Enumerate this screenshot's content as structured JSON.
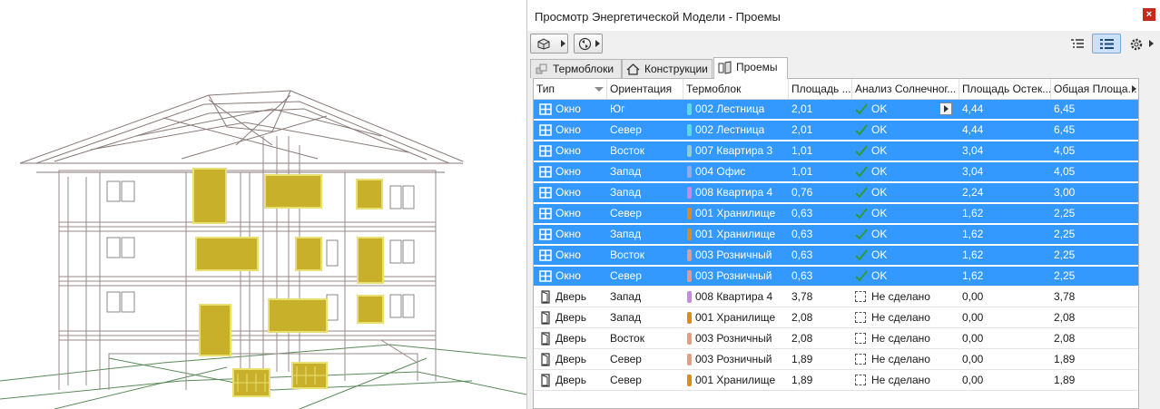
{
  "window": {
    "title": "Просмотр Энергетической Модели - Проемы",
    "close_glyph": "×"
  },
  "toolbar": {
    "left_buttons": [
      "model-3d-icon",
      "refresh-icon"
    ],
    "right_buttons": [
      "tree-view-icon",
      "list-view-icon",
      "settings-gear-icon"
    ]
  },
  "tabs": [
    {
      "label": "Термоблоки",
      "icon": "thermal-block-icon",
      "active": false
    },
    {
      "label": "Конструкции",
      "icon": "house-structure-icon",
      "active": false
    },
    {
      "label": "Проемы",
      "icon": "openings-icon",
      "active": true
    }
  ],
  "table": {
    "columns": [
      "Тип",
      "Ориентация",
      "Термоблок",
      "Площадь ...",
      "Анализ Солнечног...",
      "Площадь Остек...",
      "Общая Площа..."
    ],
    "rows": [
      {
        "type": "Окно",
        "orient": "Юг",
        "block": "002 Лестница",
        "color": "#5fd8e6",
        "area": "2,01",
        "status": "OK",
        "glazed": "4,44",
        "total": "6,45",
        "selected": true
      },
      {
        "type": "Окно",
        "orient": "Север",
        "block": "002 Лестница",
        "color": "#5fd8e6",
        "area": "2,01",
        "status": "OK",
        "glazed": "4,44",
        "total": "6,45",
        "selected": true
      },
      {
        "type": "Окно",
        "orient": "Восток",
        "block": "007 Квартира 3",
        "color": "#8fd0c8",
        "area": "1,01",
        "status": "OK",
        "glazed": "3,04",
        "total": "4,05",
        "selected": true
      },
      {
        "type": "Окно",
        "orient": "Запад",
        "block": "004 Офис",
        "color": "#9fa6e6",
        "area": "1,01",
        "status": "OK",
        "glazed": "3,04",
        "total": "4,05",
        "selected": true
      },
      {
        "type": "Окно",
        "orient": "Запад",
        "block": "008 Квартира 4",
        "color": "#c58be0",
        "area": "0,76",
        "status": "OK",
        "glazed": "2,24",
        "total": "3,00",
        "selected": true
      },
      {
        "type": "Окно",
        "orient": "Север",
        "block": "001 Хранилище",
        "color": "#e08a1a",
        "area": "0,63",
        "status": "OK",
        "glazed": "1,62",
        "total": "2,25",
        "selected": true
      },
      {
        "type": "Окно",
        "orient": "Запад",
        "block": "001 Хранилище",
        "color": "#e08a1a",
        "area": "0,63",
        "status": "OK",
        "glazed": "1,62",
        "total": "2,25",
        "selected": true
      },
      {
        "type": "Окно",
        "orient": "Восток",
        "block": "003 Розничный",
        "color": "#e89a86",
        "area": "0,63",
        "status": "OK",
        "glazed": "1,62",
        "total": "2,25",
        "selected": true
      },
      {
        "type": "Окно",
        "orient": "Север",
        "block": "003 Розничный",
        "color": "#e89a86",
        "area": "0,63",
        "status": "OK",
        "glazed": "1,62",
        "total": "2,25",
        "selected": true
      },
      {
        "type": "Дверь",
        "orient": "Запад",
        "block": "008 Квартира 4",
        "color": "#c58be0",
        "area": "3,78",
        "status": "Не сделано",
        "glazed": "0,00",
        "total": "3,78",
        "selected": false
      },
      {
        "type": "Дверь",
        "orient": "Запад",
        "block": "001 Хранилище",
        "color": "#e08a1a",
        "area": "2,08",
        "status": "Не сделано",
        "glazed": "0,00",
        "total": "2,08",
        "selected": false
      },
      {
        "type": "Дверь",
        "orient": "Восток",
        "block": "003 Розничный",
        "color": "#e89a86",
        "area": "2,08",
        "status": "Не сделано",
        "glazed": "0,00",
        "total": "2,08",
        "selected": false
      },
      {
        "type": "Дверь",
        "orient": "Север",
        "block": "003 Розничный",
        "color": "#e89a86",
        "area": "1,89",
        "status": "Не сделано",
        "glazed": "0,00",
        "total": "1,89",
        "selected": false
      },
      {
        "type": "Дверь",
        "orient": "Север",
        "block": "001 Хранилище",
        "color": "#e08a1a",
        "area": "1,89",
        "status": "Не сделано",
        "glazed": "0,00",
        "total": "1,89",
        "selected": false
      }
    ]
  },
  "colors": {
    "selection": "#3399ff",
    "ok_check": "#2e9b3a",
    "window_highlight": "#c8b02a"
  }
}
